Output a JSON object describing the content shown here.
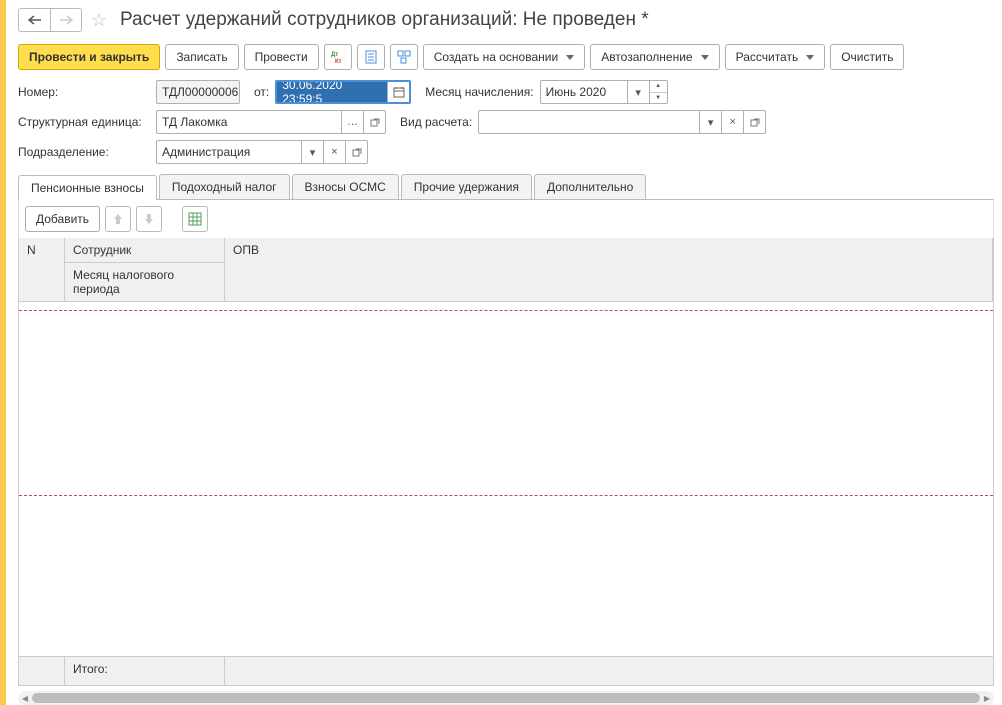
{
  "header": {
    "title": "Расчет удержаний сотрудников организаций: Не проведен *"
  },
  "toolbar": {
    "post_close": "Провести и закрыть",
    "write": "Записать",
    "post": "Провести",
    "create_based": "Создать на основании",
    "autofill": "Автозаполнение",
    "calculate": "Рассчитать",
    "clear": "Очистить"
  },
  "labels": {
    "number": "Номер:",
    "from": "от:",
    "accrual_month": "Месяц начисления:",
    "structural_unit": "Структурная единица:",
    "calc_type": "Вид расчета:",
    "department": "Подразделение:"
  },
  "fields": {
    "number": "ТДЛ00000006",
    "date": "30.06.2020 23:59:5",
    "month": "Июнь 2020",
    "structural_unit": "ТД Лакомка",
    "calc_type": "",
    "department": "Администрация"
  },
  "tabs": {
    "pension": "Пенсионные взносы",
    "income_tax": "Подоходный налог",
    "osms": "Взносы ОСМС",
    "other": "Прочие удержания",
    "extra": "Дополнительно"
  },
  "subtoolbar": {
    "add": "Добавить"
  },
  "grid": {
    "col_n": "N",
    "col_emp": "Сотрудник",
    "col_period": "Месяц налогового периода",
    "col_opv": "ОПВ",
    "total": "Итого:"
  }
}
